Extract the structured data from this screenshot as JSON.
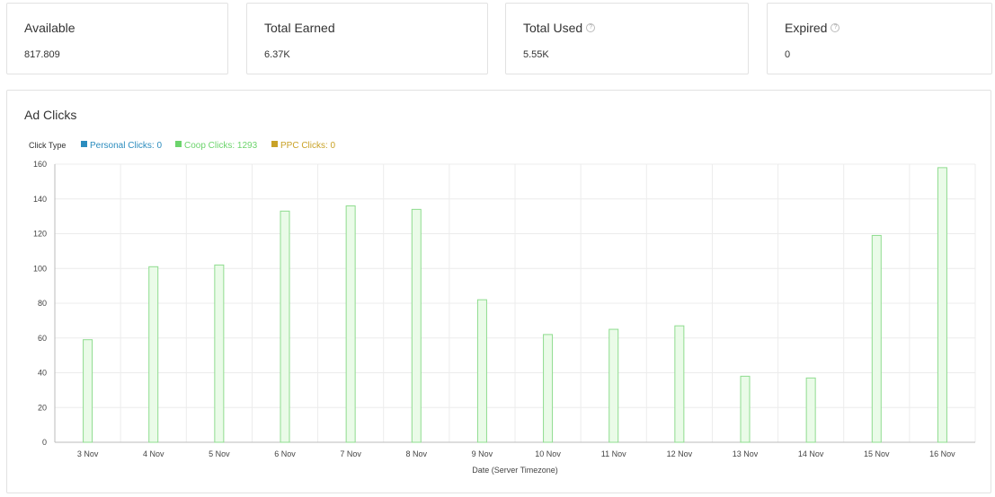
{
  "cards": [
    {
      "title": "Available",
      "value": "817.809",
      "help": false
    },
    {
      "title": "Total Earned",
      "value": "6.37K",
      "help": false
    },
    {
      "title": "Total Used",
      "value": "5.55K",
      "help": true
    },
    {
      "title": "Expired",
      "value": "0",
      "help": true
    }
  ],
  "help_glyph": "?",
  "panel": {
    "title": "Ad Clicks"
  },
  "colors": {
    "personal": "#2b8cbe",
    "coop": "#6cd46c",
    "ppc": "#c9a227",
    "bar_fill": "#eafbe8",
    "bar_stroke": "#8fdc8f",
    "grid": "#ececec",
    "axis": "#bbbbbb"
  },
  "chart_data": {
    "type": "bar",
    "legend_title": "Click Type",
    "legend": [
      {
        "name": "Personal Clicks: 0",
        "color": "#2b8cbe"
      },
      {
        "name": "Coop Clicks: 1293",
        "color": "#6cd46c"
      },
      {
        "name": "PPC Clicks: 0",
        "color": "#c9a227"
      }
    ],
    "categories": [
      "3 Nov",
      "4 Nov",
      "5 Nov",
      "6 Nov",
      "7 Nov",
      "8 Nov",
      "9 Nov",
      "10 Nov",
      "11 Nov",
      "12 Nov",
      "13 Nov",
      "14 Nov",
      "15 Nov",
      "16 Nov"
    ],
    "series": [
      {
        "name": "Coop Clicks",
        "values": [
          59,
          101,
          102,
          133,
          136,
          134,
          82,
          62,
          65,
          67,
          38,
          37,
          119,
          158
        ]
      }
    ],
    "xlabel": "Date (Server Timezone)",
    "ylabel": "",
    "ylim": [
      0,
      160
    ],
    "yticks": [
      0,
      20,
      40,
      60,
      80,
      100,
      120,
      140,
      160
    ],
    "grid": true,
    "legend_position": "top-left"
  }
}
